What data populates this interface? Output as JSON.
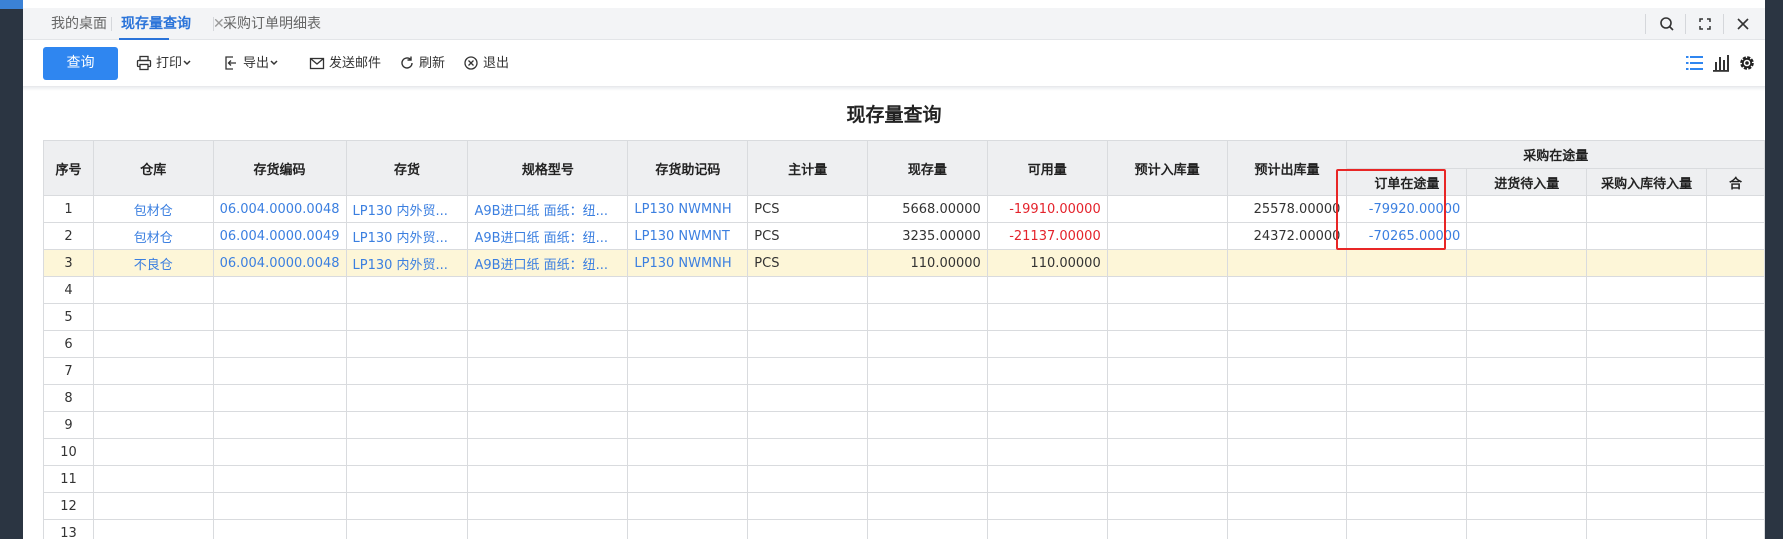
{
  "tabs": [
    {
      "label": "我的桌面",
      "active": false
    },
    {
      "label": "现存量查询",
      "active": true,
      "closable": true
    },
    {
      "label": "采购订单明细表",
      "active": false
    }
  ],
  "tab_tools": [
    "search-icon",
    "fullscreen-icon",
    "close-icon"
  ],
  "toolbar": {
    "query_label": "查询",
    "print_label": "打印",
    "export_label": "导出",
    "email_label": "发送邮件",
    "refresh_label": "刷新",
    "exit_label": "退出",
    "right_icons": [
      "list-view-icon",
      "chart-view-icon",
      "settings-icon"
    ]
  },
  "report": {
    "title": "现存量查询",
    "group_header": "采购在途量",
    "columns": [
      "序号",
      "仓库",
      "存货编码",
      "存货",
      "规格型号",
      "存货助记码",
      "主计量",
      "现存量",
      "可用量",
      "预计入库量",
      "预计出库量",
      "订单在途量",
      "进货待入量",
      "采购入库待入量",
      "合"
    ],
    "rows": [
      [
        "1",
        "包材仓",
        "06.004.0000.0048",
        "LP130 内外贸...",
        "A9B进口纸 面纸：纽...",
        "LP130 NWMNH",
        "PCS",
        "5668.00000",
        "-19910.00000",
        "",
        "25578.00000",
        "-79920.00000",
        "",
        "",
        ""
      ],
      [
        "2",
        "包材仓",
        "06.004.0000.0049",
        "LP130 内外贸...",
        "A9B进口纸 面纸：纽...",
        "LP130 NWMNT",
        "PCS",
        "3235.00000",
        "-21137.00000",
        "",
        "24372.00000",
        "-70265.00000",
        "",
        "",
        ""
      ],
      [
        "3",
        "不良仓",
        "06.004.0000.0048",
        "LP130 内外贸...",
        "A9B进口纸 面纸：纽...",
        "LP130 NWMNH",
        "PCS",
        "110.00000",
        "110.00000",
        "",
        "",
        "",
        "",
        "",
        ""
      ],
      [
        "4",
        "",
        "",
        "",
        "",
        "",
        "",
        "",
        "",
        "",
        "",
        "",
        "",
        "",
        ""
      ],
      [
        "5",
        "",
        "",
        "",
        "",
        "",
        "",
        "",
        "",
        "",
        "",
        "",
        "",
        "",
        ""
      ],
      [
        "6",
        "",
        "",
        "",
        "",
        "",
        "",
        "",
        "",
        "",
        "",
        "",
        "",
        "",
        ""
      ],
      [
        "7",
        "",
        "",
        "",
        "",
        "",
        "",
        "",
        "",
        "",
        "",
        "",
        "",
        "",
        ""
      ],
      [
        "8",
        "",
        "",
        "",
        "",
        "",
        "",
        "",
        "",
        "",
        "",
        "",
        "",
        "",
        ""
      ],
      [
        "9",
        "",
        "",
        "",
        "",
        "",
        "",
        "",
        "",
        "",
        "",
        "",
        "",
        "",
        ""
      ],
      [
        "10",
        "",
        "",
        "",
        "",
        "",
        "",
        "",
        "",
        "",
        "",
        "",
        "",
        "",
        ""
      ],
      [
        "11",
        "",
        "",
        "",
        "",
        "",
        "",
        "",
        "",
        "",
        "",
        "",
        "",
        "",
        ""
      ],
      [
        "12",
        "",
        "",
        "",
        "",
        "",
        "",
        "",
        "",
        "",
        "",
        "",
        "",
        "",
        ""
      ],
      [
        "13",
        "",
        "",
        "",
        "",
        "",
        "",
        "",
        "",
        "",
        "",
        "",
        "",
        "",
        ""
      ]
    ],
    "selected_row": 2,
    "highlighted_column": "订单在途量"
  },
  "colors": {
    "accent": "#2f86f0",
    "link": "#3b7fe0",
    "negative": "#e4232c",
    "selected_row": "#fdf6d8",
    "highlight_box": "#e82626"
  }
}
